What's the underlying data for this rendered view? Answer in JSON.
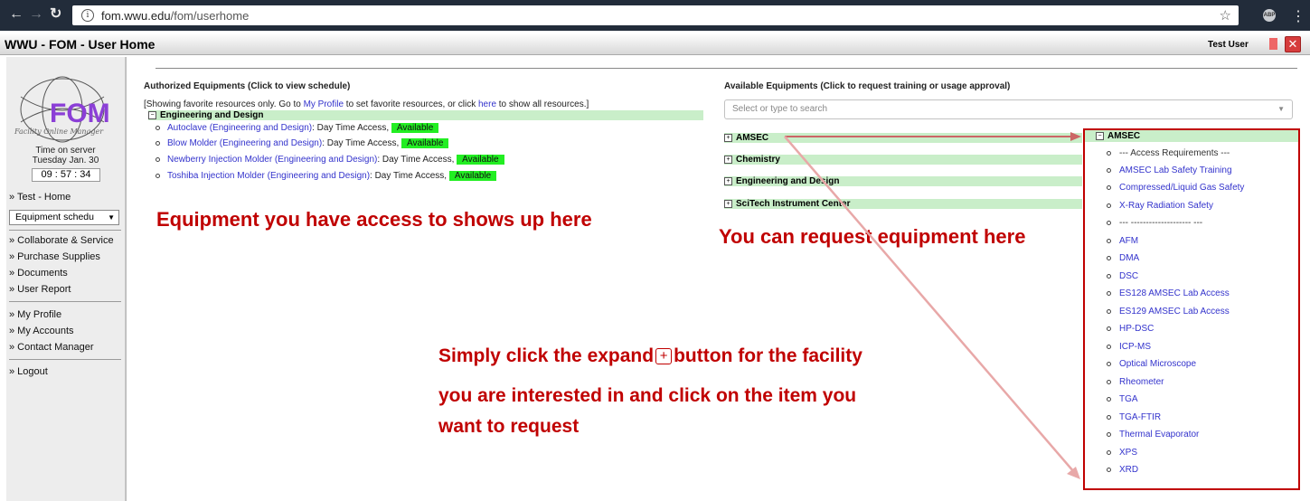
{
  "browser": {
    "url_host": "fom.wwu.edu",
    "url_path": "/fom/userhome",
    "ext_label": "ABP"
  },
  "app": {
    "title": "WWU - FOM - User Home",
    "user": "Test User"
  },
  "sidebar": {
    "logo_text": "FOM",
    "logo_caption": "Facility Online Manager",
    "time_label": "Time on server",
    "date": "Tuesday Jan. 30",
    "clock": "09 : 57 : 34",
    "home_link": "» Test - Home",
    "select_value": "Equipment schedu",
    "links_group1": [
      "» Collaborate & Service",
      "» Purchase Supplies",
      "» Documents",
      "» User Report"
    ],
    "links_group2": [
      "» My Profile",
      "» My Accounts",
      "» Contact Manager"
    ],
    "logout": "» Logout"
  },
  "authorized": {
    "heading": "Authorized Equipments (Click to view schedule)",
    "note_prefix": "[Showing favorite resources only. Go to ",
    "note_link1": "My Profile",
    "note_mid": " to set favorite resources, or click ",
    "note_link2": "here",
    "note_suffix": " to show all resources.]",
    "group": "Engineering and Design",
    "items": [
      {
        "name": "Autoclave (Engineering and Design)",
        "access": ": Day Time Access, ",
        "status": "Available"
      },
      {
        "name": "Blow Molder (Engineering and Design)",
        "access": ": Day Time Access, ",
        "status": "Available"
      },
      {
        "name": "Newberry Injection Molder (Engineering and Design)",
        "access": ": Day Time Access, ",
        "status": "Available"
      },
      {
        "name": "Toshiba Injection Molder (Engineering and Design)",
        "access": ": Day Time Access, ",
        "status": "Available"
      }
    ]
  },
  "available": {
    "heading": "Available Equipments (Click to request training or usage approval)",
    "search_placeholder": "Select or type to search",
    "facilities": [
      "AMSEC",
      "Chemistry",
      "Engineering and Design",
      "SciTech Instrument Center"
    ],
    "expanded_title": "AMSEC",
    "items": [
      {
        "label": "--- Access Requirements ---",
        "link": false
      },
      {
        "label": "AMSEC Lab Safety Training",
        "link": true
      },
      {
        "label": "Compressed/Liquid Gas Safety",
        "link": true
      },
      {
        "label": "X-Ray Radiation Safety",
        "link": true
      },
      {
        "label": "--- -------------------- ---",
        "link": false
      },
      {
        "label": "AFM",
        "link": true
      },
      {
        "label": "DMA",
        "link": true
      },
      {
        "label": "DSC",
        "link": true
      },
      {
        "label": "ES128 AMSEC Lab Access",
        "link": true
      },
      {
        "label": "ES129 AMSEC Lab Access",
        "link": true
      },
      {
        "label": "HP-DSC",
        "link": true
      },
      {
        "label": "ICP-MS",
        "link": true
      },
      {
        "label": "Optical Microscope",
        "link": true
      },
      {
        "label": "Rheometer",
        "link": true
      },
      {
        "label": "TGA",
        "link": true
      },
      {
        "label": "TGA-FTIR",
        "link": true
      },
      {
        "label": "Thermal Evaporator",
        "link": true
      },
      {
        "label": "XPS",
        "link": true
      },
      {
        "label": "XRD",
        "link": true
      }
    ]
  },
  "annotations": {
    "access": "Equipment you have access to shows up here",
    "request": "You can request equipment here",
    "instruction_line1a": "Simply click the expand",
    "instruction_line1b": "button for the facility",
    "instruction_line2": "you are interested in and click on the item you",
    "instruction_line3": "want to request"
  },
  "colors": {
    "annotation": "#c00000",
    "available_badge": "#22ee22",
    "group_bg": "#c9eec9",
    "link": "#3333cc"
  }
}
